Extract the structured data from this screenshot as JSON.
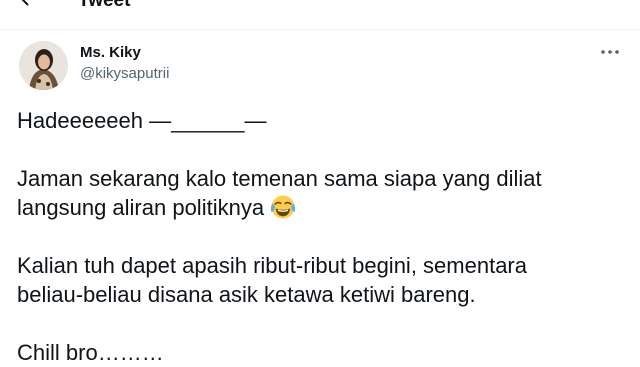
{
  "header": {
    "title": "Tweet",
    "back_icon": "arrow-left-icon"
  },
  "author": {
    "name": "Ms. Kiky",
    "handle": "@kikysaputrii",
    "avatar": "profile-photo"
  },
  "tweet": {
    "line1": "Hadeeeeeeh —______—",
    "line2a": "Jaman sekarang kalo temenan sama siapa yang diliat",
    "line2b": "langsung aliran politiknya",
    "line2_emoji": "face-with-tears-of-joy",
    "line3a": "Kalian tuh dapet apasih ribut-ribut begini, sementara",
    "line3b": "beliau-beliau disana asik ketawa ketiwi bareng.",
    "line4": "Chill bro………"
  },
  "more_icon": "more-horizontal-icon",
  "colors": {
    "text": "#0f1419",
    "secondary": "#536471",
    "divider": "#eff3f4"
  }
}
